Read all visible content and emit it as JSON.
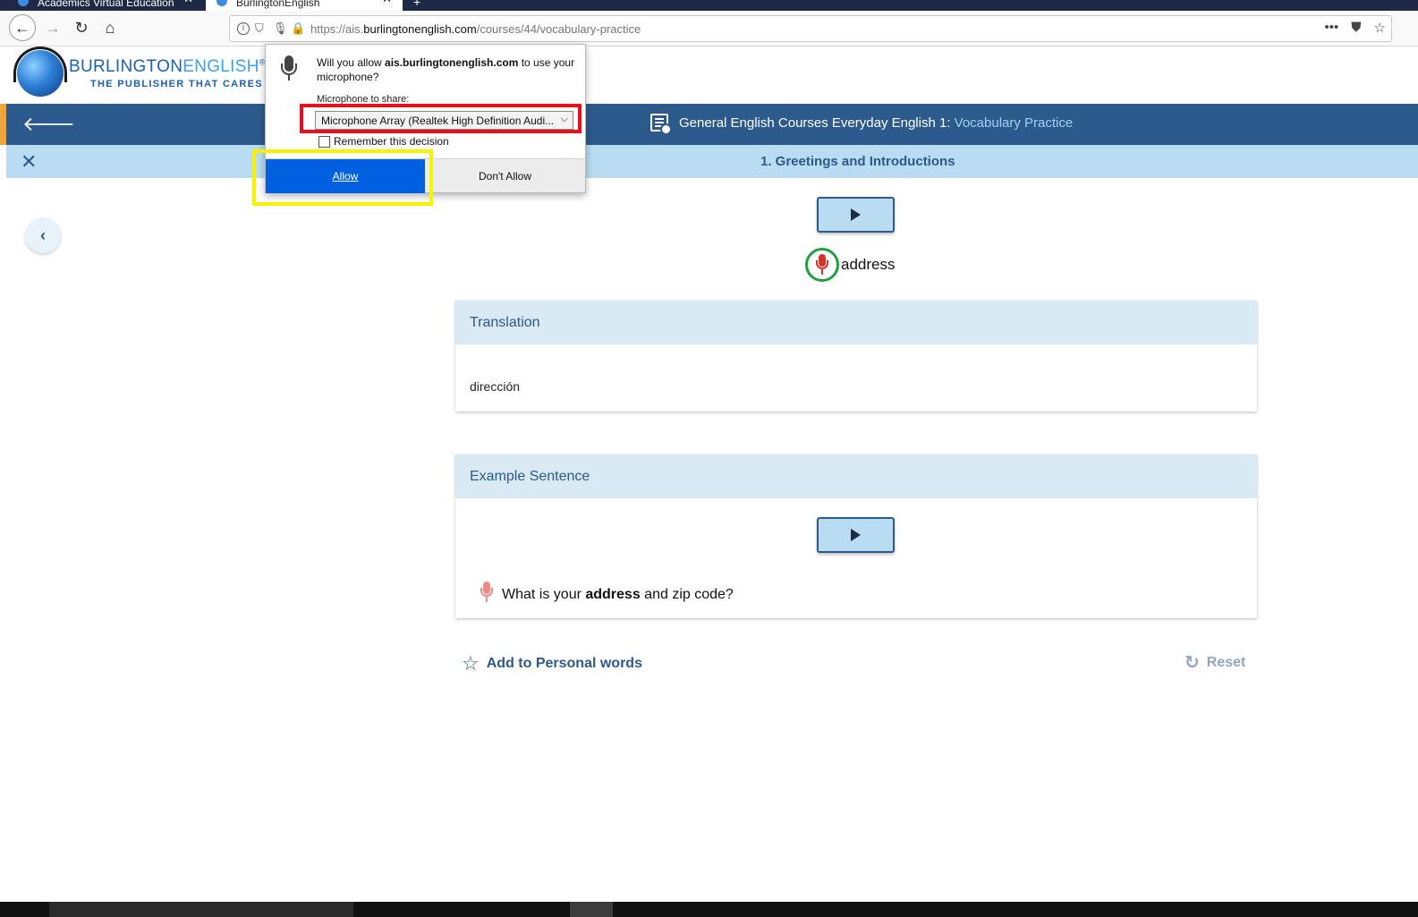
{
  "browser": {
    "tabs": [
      {
        "label": "Academics Virtual Education"
      },
      {
        "label": "BurlingtonEnglish"
      }
    ],
    "new_tab": "+",
    "url": {
      "prefix": "https://ais.",
      "domain": "burlingtonenglish.com",
      "path": "/courses/44/vocabulary-practice"
    },
    "icons": {
      "back": "back-arrow-icon",
      "forward": "forward-arrow-icon",
      "reload": "reload-icon",
      "home": "home-icon",
      "more": "more-icon",
      "pocket": "pocket-icon",
      "bookmark": "star-icon"
    }
  },
  "logo": {
    "main_part1": "BURLINGTON",
    "main_part2": "ENGLISH",
    "registered": "®",
    "tagline": "THE PUBLISHER THAT CARES"
  },
  "course_bar": {
    "title_prefix": "General English Courses Everyday English 1: ",
    "title_highlight": "Vocabulary Practice"
  },
  "lesson_bar": {
    "title": "1. Greetings and Introductions"
  },
  "word": {
    "text": "address"
  },
  "translation_card": {
    "heading": "Translation",
    "text": "dirección"
  },
  "example_card": {
    "heading": "Example Sentence",
    "sentence_before": "What is your ",
    "sentence_bold": "address",
    "sentence_after": " and zip code?"
  },
  "actions": {
    "add_personal": "Add to Personal words",
    "reset": "Reset"
  },
  "permission_popup": {
    "question_before": "Will you allow ",
    "question_domain": "ais.burlingtonenglish.com",
    "question_after": " to use your microphone?",
    "share_label": "Microphone to share:",
    "selected_device": "Microphone Array (Realtek High Definition Audi...",
    "remember_label": "Remember this decision",
    "remember_checked": false,
    "allow_label": "Allow",
    "dont_allow_label": "Don't Allow"
  },
  "colors": {
    "primary_blue": "#2d5a8c",
    "light_blue": "#b9dcf2",
    "allow_button": "#0060df",
    "mic_red": "#d8302a",
    "annotation_red": "#e8101a",
    "annotation_yellow": "#f7f200",
    "annotation_green": "#1fa040"
  }
}
